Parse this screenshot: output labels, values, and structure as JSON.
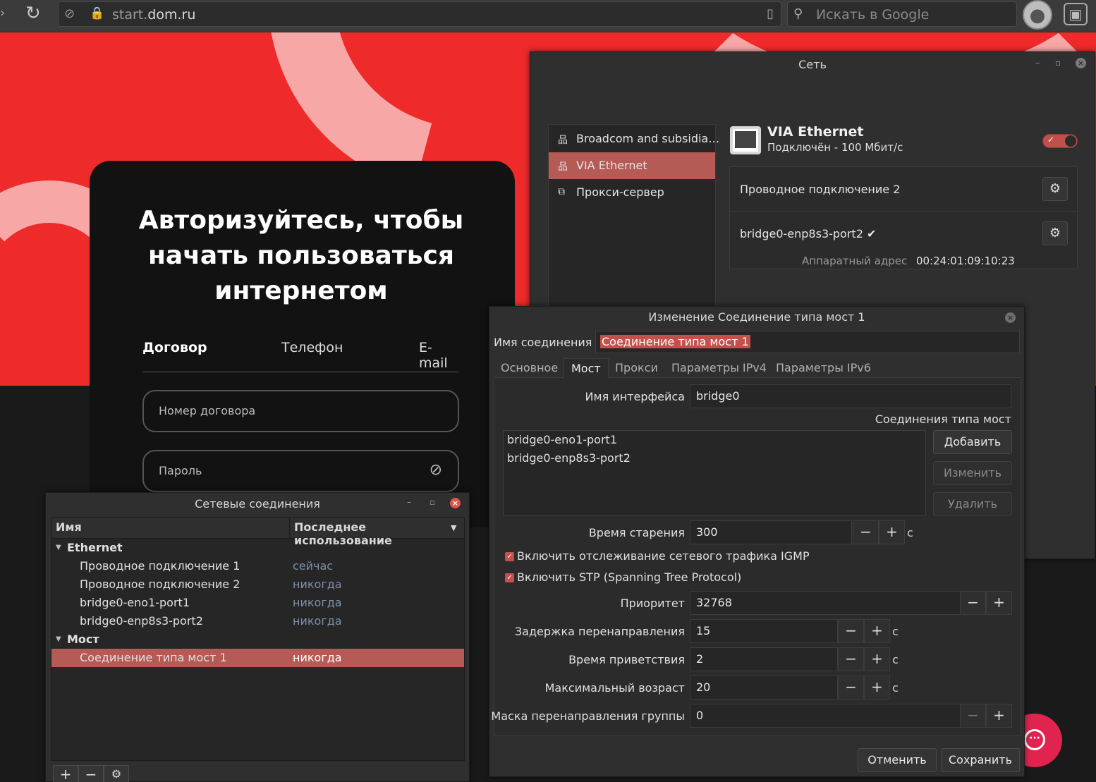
{
  "browser": {
    "url_host": "start.",
    "url_domain": "dom.ru",
    "search_placeholder": "Искать в Google"
  },
  "colors": {
    "site_red": "#ee2a2a",
    "site_pink": "#f8a7a7",
    "selection": "#b55a55",
    "chat_accent": "#e0244f"
  },
  "login": {
    "title": "Авторизуйтесь, чтобы начать пользоваться интернетом",
    "tabs": [
      "Договор",
      "Телефон",
      "E-mail"
    ],
    "contract_placeholder": "Номер договора",
    "password_placeholder": "Пароль"
  },
  "network_window": {
    "title": "Сеть",
    "sidebar": [
      {
        "label": "Broadcom and subsidia…",
        "icon": "network-wired-icon"
      },
      {
        "label": "VIA Ethernet",
        "icon": "network-wired-icon"
      },
      {
        "label": "Прокси-сервер",
        "icon": "proxy-icon"
      }
    ],
    "device_name": "VIA Ethernet",
    "device_status": "Подключён - 100 Мбит/с",
    "profiles": [
      "Проводное подключение 2",
      "bridge0-enp8s3-port2"
    ],
    "hw_address_label": "Аппаратный адрес",
    "hw_address": "00:24:01:09:10:23"
  },
  "connections_window": {
    "title": "Сетевые соединения",
    "col_name": "Имя",
    "col_last_used": "Последнее использование",
    "groups": [
      {
        "name": "Ethernet",
        "items": [
          {
            "name": "Проводное подключение 1",
            "last_used": "сейчас"
          },
          {
            "name": "Проводное подключение 2",
            "last_used": "никогда"
          },
          {
            "name": "bridge0-eno1-port1",
            "last_used": "никогда"
          },
          {
            "name": "bridge0-enp8s3-port2",
            "last_used": "никогда"
          }
        ]
      },
      {
        "name": "Мост",
        "items": [
          {
            "name": "Соединение типа мост 1",
            "last_used": "никогда"
          }
        ]
      }
    ]
  },
  "edit_dialog": {
    "title": "Изменение Соединение типа мост 1",
    "conn_name_label": "Имя соединения",
    "conn_name": "Соединение типа мост 1",
    "tabs": [
      "Основное",
      "Мост",
      "Прокси",
      "Параметры IPv4",
      "Параметры IPv6"
    ],
    "iface_label": "Имя интерфейса",
    "iface_value": "bridge0",
    "bridged_label": "Соединения типа мост",
    "bridged_list": [
      "bridge0-eno1-port1",
      "bridge0-enp8s3-port2"
    ],
    "btn_add": "Добавить",
    "btn_edit": "Изменить",
    "btn_delete": "Удалить",
    "aging_label": "Время старения",
    "aging_value": "300",
    "igmp_label": "Включить отслеживание сетевого трафика IGMP",
    "stp_label": "Включить STP (Spanning Tree Protocol)",
    "priority_label": "Приоритет",
    "priority_value": "32768",
    "fwd_delay_label": "Задержка перенаправления",
    "fwd_delay_value": "15",
    "hello_label": "Время приветствия",
    "hello_value": "2",
    "max_age_label": "Максимальный возраст",
    "max_age_value": "20",
    "group_mask_label": "Маска перенаправления группы",
    "group_mask_value": "0",
    "unit_sec": "с",
    "btn_cancel": "Отменить",
    "btn_save": "Сохранить"
  }
}
